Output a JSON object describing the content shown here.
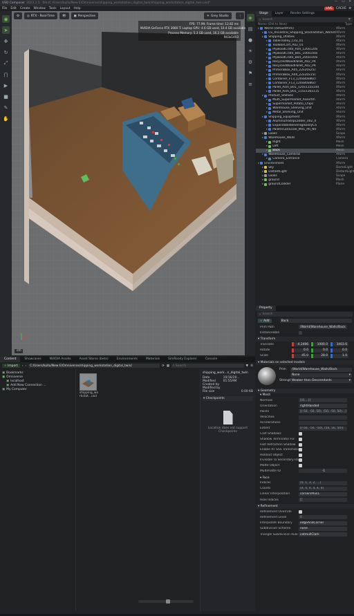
{
  "titlebar": {
    "app": "USD Composer",
    "version": "2023.2.5",
    "file": "file:/C:/Users/kullu/New E/Omniverse/shipping_workstation_digital_twin/shipping_workstation_digital_twin.usd*"
  },
  "menubar": {
    "items": [
      "File",
      "Edit",
      "Create",
      "Window",
      "Tools",
      "Layout",
      "Help"
    ],
    "path": "shipping_workstation_digital_twin.usd*",
    "live": "LIVE",
    "cache": "CACHE"
  },
  "viewport": {
    "renderer": "RTX - Real-Time",
    "camera": "Perspective",
    "lighting": "Grey Studio",
    "stats": [
      "FPS: 77.99, Frame time: 12.82 ms",
      "NVIDIA GeForce RTX 3080 Ti Laptop GPU: 4.6 GB used, 10.4 GB available",
      "Process Memory: 5.3 GB used, 16.2 GB available",
      "943x1403"
    ],
    "units": "cm"
  },
  "stage": {
    "tabs": [
      "Stage",
      "Layer",
      "Render Settings"
    ],
    "search_placeholder": "Search",
    "col_name": "Name (Old to New)",
    "col_type": "Type",
    "rows": [
      {
        "indent": 0,
        "icon": "x",
        "name": "World (defaultPrim)",
        "type": "Xform"
      },
      {
        "indent": 1,
        "icon": "x",
        "name": "CS_Ancestral_Shipping_StockStation_Worksta",
        "type": "Xform"
      },
      {
        "indent": 1,
        "icon": "x",
        "name": "Shipping_Utilities",
        "type": "Xform"
      },
      {
        "indent": 2,
        "icon": "x",
        "name": "TableTrolley_C03_01",
        "type": "Xform"
      },
      {
        "indent": 2,
        "icon": "x",
        "name": "ToolBoxCart_A02_01",
        "type": "Xform"
      },
      {
        "indent": 2,
        "icon": "x",
        "name": "PlywoodCrate_A04_120x120x",
        "type": "Xform"
      },
      {
        "indent": 2,
        "icon": "x",
        "name": "PlywoodCrate_B01_100x100x",
        "type": "Xform"
      },
      {
        "indent": 2,
        "icon": "x",
        "name": "PlywoodCrate_B04_200x100x",
        "type": "Xform"
      },
      {
        "indent": 2,
        "icon": "x",
        "name": "RecycledWoodPallet_A02_PR",
        "type": "Xform"
      },
      {
        "indent": 2,
        "icon": "x",
        "name": "RecycledWoodPallet_A02_PR",
        "type": "Xform"
      },
      {
        "indent": 2,
        "icon": "x",
        "name": "PrimeraBox_A05_22x20x25c",
        "type": "Xform"
      },
      {
        "indent": 2,
        "icon": "x",
        "name": "PrimeraBox_A04_22x20x15c",
        "type": "Xform"
      },
      {
        "indent": 2,
        "icon": "x",
        "name": "Container_F13_120x80x86cr",
        "type": "Xform"
      },
      {
        "indent": 2,
        "icon": "x",
        "name": "Container_F13_120x80x86cr",
        "type": "Xform"
      },
      {
        "indent": 2,
        "icon": "x",
        "name": "Pallet_Asm_B01_120x115x144",
        "type": "Xform"
      },
      {
        "indent": 2,
        "icon": "x",
        "name": "Pallet_Asm_B01_115x136x115",
        "type": "Xform"
      },
      {
        "indent": 1,
        "icon": "x",
        "name": "Product_Shelves",
        "type": "Xform"
      },
      {
        "indent": 2,
        "icon": "x",
        "name": "Multi_Supermarket_Assortm",
        "type": "Xform"
      },
      {
        "indent": 2,
        "icon": "x",
        "name": "Supermarket_Potato_Chips",
        "type": "Xform"
      },
      {
        "indent": 2,
        "icon": "x",
        "name": "Warehouse_Shelving_Unit",
        "type": "Xform"
      },
      {
        "indent": 2,
        "icon": "x",
        "name": "Metal_Shelving_Unit",
        "type": "Xform"
      },
      {
        "indent": 1,
        "icon": "x",
        "name": "Shipping_Equipment",
        "type": "Xform"
      },
      {
        "indent": 2,
        "icon": "x",
        "name": "AluminumStepLadder_002_0",
        "type": "Xform"
      },
      {
        "indent": 2,
        "icon": "x",
        "name": "ExpandableBeverageDollyCa",
        "type": "Xform"
      },
      {
        "indent": 2,
        "icon": "x",
        "name": "PalletTruckScale_M01_PR_NV",
        "type": "Xform"
      },
      {
        "indent": 1,
        "icon": "s",
        "name": "Looks",
        "type": "Scope"
      },
      {
        "indent": 1,
        "icon": "x",
        "name": "Warehouse_Walls",
        "type": "Xform"
      },
      {
        "indent": 2,
        "icon": "m",
        "name": "Right",
        "type": "Mesh"
      },
      {
        "indent": 2,
        "icon": "m",
        "name": "Left",
        "type": "Mesh"
      },
      {
        "indent": 2,
        "icon": "m",
        "name": "Back",
        "type": "Mesh",
        "selected": true
      },
      {
        "indent": 1,
        "icon": "x",
        "name": "Warehouse_Cameras",
        "type": "Xform"
      },
      {
        "indent": 2,
        "icon": "c",
        "name": "Camera_Entrance",
        "type": "Camera"
      },
      {
        "indent": 0,
        "icon": "x",
        "name": "Environment",
        "type": "Xform"
      },
      {
        "indent": 1,
        "icon": "l",
        "name": "Sky",
        "type": "DomeLight"
      },
      {
        "indent": 1,
        "icon": "l",
        "name": "DistantLight",
        "type": "DistantLight"
      },
      {
        "indent": 1,
        "icon": "s",
        "name": "Looks",
        "type": "Scope"
      },
      {
        "indent": 1,
        "icon": "m",
        "name": "ground",
        "type": "Mesh"
      },
      {
        "indent": 1,
        "icon": "m",
        "name": "groundCollider",
        "type": "Plane"
      }
    ]
  },
  "property": {
    "tab": "Property",
    "search_placeholder": "Search",
    "add_label": "Add",
    "prim_name": "Back",
    "prim_path_label": "Prim Path",
    "prim_path": "/World/Warehouse_Walls/Back",
    "instanceable_label": "Instanceable",
    "transform_title": "Transform",
    "translate_label": "Translate",
    "translate": [
      "-4.2496",
      "1000.0",
      "3403.6"
    ],
    "rotate_label": "Rotate",
    "rotate": [
      "0.0",
      "0.0",
      "0.0"
    ],
    "scale_label": "Scale",
    "scale": [
      "45.0",
      "28.0",
      "1.0"
    ],
    "materials_title": "Materials on selected models",
    "prim_label": "Prim",
    "prim_value": "/World/Warehouse_Walls/Back",
    "material_value": "None",
    "strength_label": "Strength",
    "strength_value": "Weaker than Descendants",
    "geometry_title": "Geometry",
    "mesh_title": "Mesh",
    "mesh_props": [
      {
        "k": "Normals",
        "v": "[(0,...)]"
      },
      {
        "k": "Orientation",
        "v": "rightHanded",
        "dd": true
      },
      {
        "k": "Points",
        "v": "[(-50, -50, 50), (50, -50, 50)...]"
      },
      {
        "k": "Velocities",
        "v": ""
      },
      {
        "k": "Accelerations",
        "v": ""
      },
      {
        "k": "Extent",
        "v": "[(-50, -50, -50), (50, 50, 50)]"
      }
    ],
    "mesh_checks": [
      "Cast Shadows",
      "Shadow Terminator Fix",
      "Fast Refraction Shadow",
      "Enable RT SSS Transmission",
      "Holdout Object",
      "Invisible To Secondary Rays",
      "Matte Object"
    ],
    "multimatte_label": "Multimatte ID",
    "multimatte_value": "-1",
    "face_title": "Face",
    "face_props": [
      {
        "k": "Indices",
        "v": "[0, 1, 3, 2, ...]"
      },
      {
        "k": "Counts",
        "v": "[4, 4, 4, 4, 4, 4]"
      },
      {
        "k": "Linear Interpolation",
        "v": "cornersPlus1",
        "dd": true
      },
      {
        "k": "Hole Indices",
        "v": "[]"
      }
    ],
    "refinement_title": "Refinement",
    "refine_props": [
      {
        "k": "Refinement Override",
        "v": "",
        "chk": true
      },
      {
        "k": "Refinement Level",
        "v": "0"
      },
      {
        "k": "Interpolate Boundary",
        "v": "edgeAndCorner",
        "dd": true
      },
      {
        "k": "Subdivision Scheme",
        "v": "none",
        "dd": true
      },
      {
        "k": "Triangle Subdivision Rule",
        "v": "catmullClark",
        "dd": true
      }
    ]
  },
  "content": {
    "tabs": [
      "Content",
      "Showcases",
      "NVIDIA Assets",
      "Asset Stores (beta)",
      "Environments",
      "Materials",
      "SimReady Explorer",
      "Console"
    ],
    "import_label": "Import",
    "path": "C:/Users/kullu/New E/Omniverse/shipping_workstation_digital_twin/",
    "search_placeholder": "Search",
    "tree": [
      {
        "indent": 0,
        "name": "Bookmarks"
      },
      {
        "indent": 0,
        "name": "Omniverse"
      },
      {
        "indent": 1,
        "name": "localhost"
      },
      {
        "indent": 1,
        "name": "Add New Connection ..."
      },
      {
        "indent": 0,
        "name": "My Computer"
      }
    ],
    "file_name": "shipping_wo rkstat...usd",
    "detail_title": "shipping_work...n_digital_twin",
    "date_label": "Date Modified",
    "date_value": "10/16/20... 01:55AM",
    "created_label": "Created by",
    "modified_label": "Modified by",
    "size_label": "File size",
    "size_value": "0.00 KB",
    "checkpoints_title": "Checkpoints",
    "checkpoints_msg": "Location does not support Checkpoints"
  }
}
